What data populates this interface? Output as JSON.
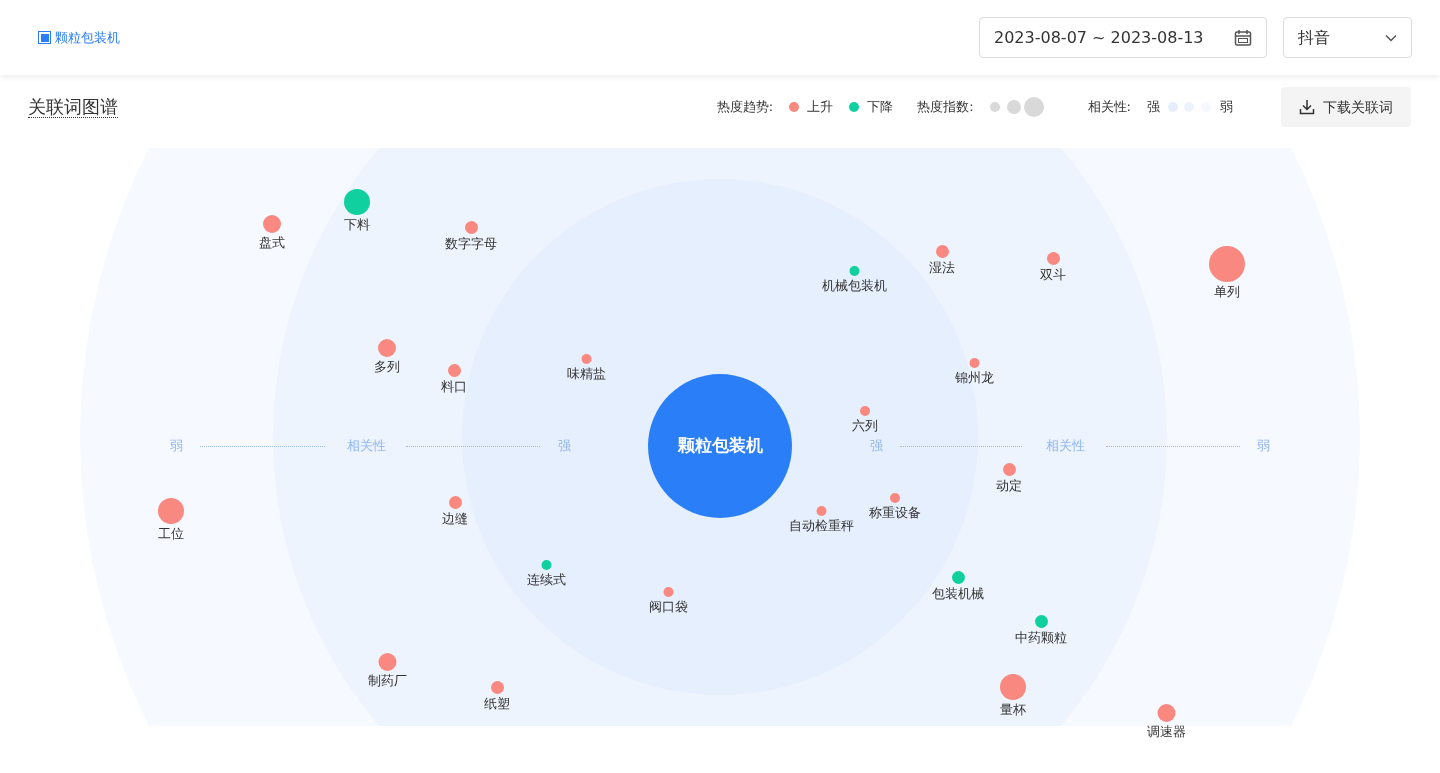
{
  "header": {
    "keyword_tag": "颗粒包装机",
    "date_range": "2023-08-07 ~ 2023-08-13",
    "platform": "抖音"
  },
  "section": {
    "title": "关联词图谱",
    "download_button": "下载关联词"
  },
  "legend": {
    "trend_label": "热度趋势:",
    "trends": [
      {
        "label": "上升",
        "color": "#f98880"
      },
      {
        "label": "下降",
        "color": "#11d0a0"
      }
    ],
    "heat_label": "热度指数:",
    "relevance_label": "相关性:",
    "relevance_strong": "强",
    "relevance_weak": "弱"
  },
  "graph": {
    "center": "颗粒包装机",
    "axis_labels": [
      "弱",
      "相关性",
      "强",
      "强",
      "相关性",
      "弱"
    ],
    "nodes": [
      {
        "label": "盘式",
        "color": "#f98880",
        "kind": "medium"
      },
      {
        "label": "下料",
        "color": "#11d0a0",
        "kind": "large"
      },
      {
        "label": "数字字母",
        "color": "#f98880",
        "kind": "small"
      },
      {
        "label": "机械包装机",
        "color": "#11d0a0",
        "kind": "tiny"
      },
      {
        "label": "湿法",
        "color": "#f98880",
        "kind": "small"
      },
      {
        "label": "双斗",
        "color": "#f98880",
        "kind": "small"
      },
      {
        "label": "单列",
        "color": "#f98880",
        "kind": "huge"
      },
      {
        "label": "多列",
        "color": "#f98880",
        "kind": "medium"
      },
      {
        "label": "料口",
        "color": "#f98880",
        "kind": "small"
      },
      {
        "label": "味精盐",
        "color": "#f98880",
        "kind": "tiny"
      },
      {
        "label": "锦州龙",
        "color": "#f98880",
        "kind": "tiny"
      },
      {
        "label": "六列",
        "color": "#f98880",
        "kind": "tiny"
      },
      {
        "label": "动定",
        "color": "#f98880",
        "kind": "small"
      },
      {
        "label": "工位",
        "color": "#f98880",
        "kind": "large"
      },
      {
        "label": "边缝",
        "color": "#f98880",
        "kind": "small"
      },
      {
        "label": "自动检重秤",
        "color": "#f98880",
        "kind": "tiny"
      },
      {
        "label": "称重设备",
        "color": "#f98880",
        "kind": "tiny"
      },
      {
        "label": "连续式",
        "color": "#11d0a0",
        "kind": "tiny"
      },
      {
        "label": "阀口袋",
        "color": "#f98880",
        "kind": "tiny"
      },
      {
        "label": "包装机械",
        "color": "#11d0a0",
        "kind": "small"
      },
      {
        "label": "中药颗粒",
        "color": "#11d0a0",
        "kind": "small"
      },
      {
        "label": "制药厂",
        "color": "#f98880",
        "kind": "medium"
      },
      {
        "label": "纸塑",
        "color": "#f98880",
        "kind": "small"
      },
      {
        "label": "量杯",
        "color": "#f98880",
        "kind": "large"
      },
      {
        "label": "调速器",
        "color": "#f98880",
        "kind": "medium"
      }
    ]
  }
}
